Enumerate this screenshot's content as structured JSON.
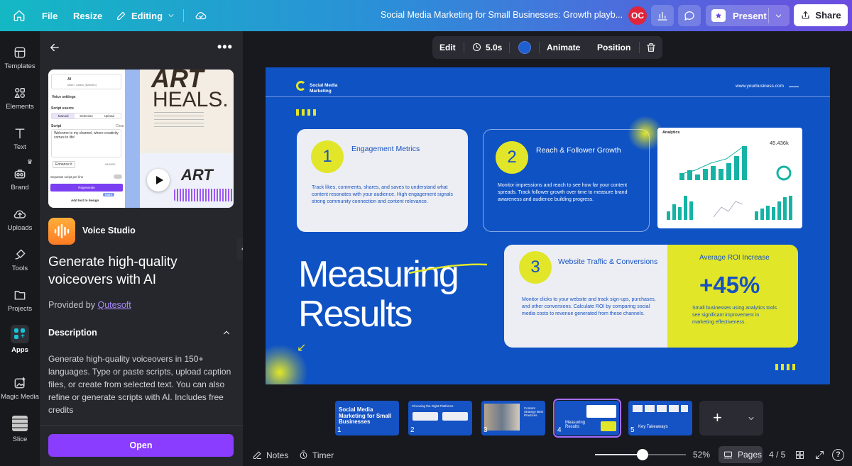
{
  "topbar": {
    "file": "File",
    "resize": "Resize",
    "editing": "Editing",
    "doc_title": "Social Media Marketing for Small Businesses: Growth playb...",
    "avatar_initials": "OC",
    "present": "Present",
    "share": "Share"
  },
  "rail": {
    "items": [
      {
        "label": "Templates",
        "icon": "templates-icon"
      },
      {
        "label": "Elements",
        "icon": "elements-icon"
      },
      {
        "label": "Text",
        "icon": "text-icon"
      },
      {
        "label": "Brand",
        "icon": "brand-icon"
      },
      {
        "label": "Uploads",
        "icon": "uploads-icon"
      },
      {
        "label": "Tools",
        "icon": "tools-icon"
      },
      {
        "label": "Projects",
        "icon": "projects-icon"
      },
      {
        "label": "Apps",
        "icon": "apps-icon"
      },
      {
        "label": "Magic Media",
        "icon": "magic-media-icon"
      },
      {
        "label": "Slice",
        "icon": "slice-icon"
      }
    ]
  },
  "panel": {
    "app_name": "Voice Studio",
    "headline": "Generate high-quality voiceovers with AI",
    "provided_by": "Provided by",
    "provider": "Qutesoft",
    "description_title": "Description",
    "description": "Generate high-quality voiceovers in 150+ languages. Type or paste scripts, upload caption files, or create from selected text. You can also refine or generate scripts with AI. Includes free credits",
    "open": "Open",
    "preview": {
      "ai": "AI",
      "voice_line": "Male • Arabic (Bahrain)",
      "voice_settings": "Voice settings",
      "script_source": "Script source",
      "tab_manual": "Manual",
      "tab_selection": "Selection",
      "tab_upload": "Upload",
      "script": "Script",
      "clear": "Clear",
      "script_text": "Welcome to my channel, where creativity comes to life!",
      "enhance": "Enhance it",
      "count": "54/5000",
      "separate": "Separate script per line",
      "regenerate": "Regenerate",
      "tooltip": "Mabi",
      "add": "Add text to design",
      "art": "ART",
      "heals": "HEALS.",
      "art_small": "ART"
    }
  },
  "floatbar": {
    "edit": "Edit",
    "duration": "5.0s",
    "animate": "Animate",
    "position": "Position",
    "color": "#1f5fd0"
  },
  "slide": {
    "brand": "Social Media Marketing",
    "url": "www.yourbusiness.com",
    "title_line1": "Measuring",
    "title_line2": "Results",
    "cards": [
      {
        "num": "1",
        "title": "Engagement Metrics",
        "body": "Track likes, comments, shares, and saves to understand what content resonates with your audience. High engagement signals strong community connection and content relevance."
      },
      {
        "num": "2",
        "title": "Reach & Follower Growth",
        "body": "Monitor impressions and reach to see how far your content spreads. Track follower growth over time to measure brand awareness and audience building progress."
      },
      {
        "num": "3",
        "title": "Website Traffic & Conversions",
        "body": "Monitor clicks to your website and track sign-ups, purchases, and other conversions. Calculate ROI by comparing social media costs to revenue generated from these channels."
      }
    ],
    "roi_label": "Average ROI Increase",
    "roi_value": "+45%",
    "roi_body": "Small businesses using analytics tools see significant improvement in marketing effectiveness.",
    "analytics_title": "Analytics",
    "analytics_stat": "45.436k",
    "colors": {
      "bg": "#0f52c4",
      "accent": "#e2e629",
      "teal": "#16b3a4"
    }
  },
  "thumbnails": [
    {
      "num": "1",
      "title": "Social Media Marketing for Small Businesses"
    },
    {
      "num": "2",
      "title": "Choosing the Right Platforms"
    },
    {
      "num": "3",
      "title": "Content Strategy Best Practices"
    },
    {
      "num": "4",
      "title": "Measuring Results"
    },
    {
      "num": "5",
      "title": "Key Takeaways"
    }
  ],
  "bottom": {
    "notes": "Notes",
    "timer": "Timer",
    "zoom": "52%",
    "pages": "Pages",
    "page_count": "4 / 5",
    "zoom_level": 0.52
  }
}
